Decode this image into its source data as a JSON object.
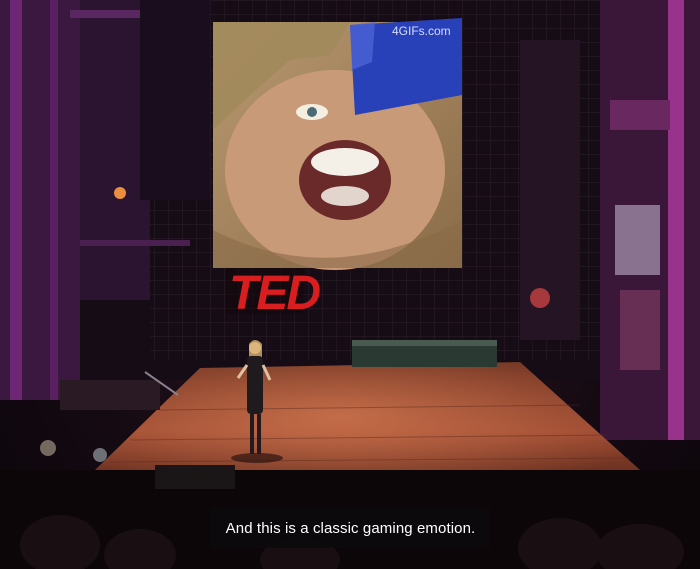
{
  "subtitle": {
    "text": "And this is a classic gaming emotion."
  },
  "screen": {
    "watermark": "4GIFs.com"
  },
  "stage": {
    "logo": "TED"
  },
  "colors": {
    "stage_floor": "#8a3e28",
    "backdrop_purple": "#3a1a40",
    "logo_red": "#d81e1e",
    "subtitle_bg": "#0c0a0c"
  }
}
